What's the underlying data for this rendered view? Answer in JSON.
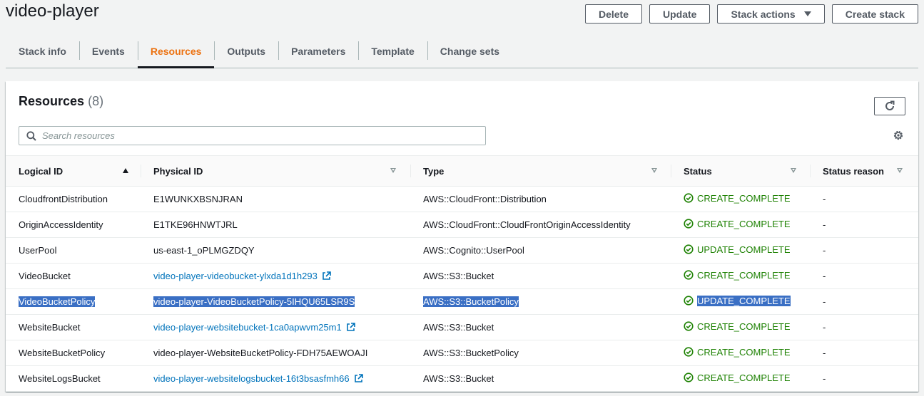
{
  "page": {
    "title": "video-player"
  },
  "header_buttons": {
    "delete": "Delete",
    "update": "Update",
    "stack_actions": "Stack actions",
    "create_stack": "Create stack"
  },
  "tabs": [
    {
      "label": "Stack info"
    },
    {
      "label": "Events"
    },
    {
      "label": "Resources",
      "active": true
    },
    {
      "label": "Outputs"
    },
    {
      "label": "Parameters"
    },
    {
      "label": "Template"
    },
    {
      "label": "Change sets"
    }
  ],
  "resources": {
    "title": "Resources",
    "count": "(8)",
    "search_placeholder": "Search resources",
    "columns": {
      "logical_id": "Logical ID",
      "physical_id": "Physical ID",
      "type": "Type",
      "status": "Status",
      "status_reason": "Status reason"
    },
    "rows": [
      {
        "logical_id": "CloudfrontDistribution",
        "physical_id": "E1WUNKXBSNJRAN",
        "link": false,
        "type": "AWS::CloudFront::Distribution",
        "status": "CREATE_COMPLETE",
        "reason": "-"
      },
      {
        "logical_id": "OriginAccessIdentity",
        "physical_id": "E1TKE96HNWTJRL",
        "link": false,
        "type": "AWS::CloudFront::CloudFrontOriginAccessIdentity",
        "status": "CREATE_COMPLETE",
        "reason": "-"
      },
      {
        "logical_id": "UserPool",
        "physical_id": "us-east-1_oPLMGZDQY",
        "link": false,
        "type": "AWS::Cognito::UserPool",
        "status": "UPDATE_COMPLETE",
        "reason": "-"
      },
      {
        "logical_id": "VideoBucket",
        "physical_id": "video-player-videobucket-ylxda1d1h293",
        "link": true,
        "type": "AWS::S3::Bucket",
        "status": "CREATE_COMPLETE",
        "reason": "-"
      },
      {
        "logical_id": "VideoBucketPolicy",
        "physical_id": "video-player-VideoBucketPolicy-5IHQU65LSR9S",
        "link": false,
        "highlighted": true,
        "type": "AWS::S3::BucketPolicy",
        "status": "UPDATE_COMPLETE",
        "reason": "-"
      },
      {
        "logical_id": "WebsiteBucket",
        "physical_id": "video-player-websitebucket-1ca0apwvm25m1",
        "link": true,
        "type": "AWS::S3::Bucket",
        "status": "CREATE_COMPLETE",
        "reason": "-"
      },
      {
        "logical_id": "WebsiteBucketPolicy",
        "physical_id": "video-player-WebsiteBucketPolicy-FDH75AEWOAJI",
        "link": false,
        "type": "AWS::S3::BucketPolicy",
        "status": "CREATE_COMPLETE",
        "reason": "-"
      },
      {
        "logical_id": "WebsiteLogsBucket",
        "physical_id": "video-player-websitelogsbucket-16t3bsasfmh66",
        "link": true,
        "type": "AWS::S3::Bucket",
        "status": "CREATE_COMPLETE",
        "reason": "-"
      }
    ]
  },
  "icons": {
    "refresh": "refresh-icon",
    "search": "search-icon",
    "settings": "gear-icon",
    "external": "external-link-icon",
    "status_ok": "check-circle-icon"
  },
  "colors": {
    "accent": "#ec7211",
    "link": "#0073bb",
    "success": "#1d8102",
    "selection": "#3a6fc4"
  }
}
